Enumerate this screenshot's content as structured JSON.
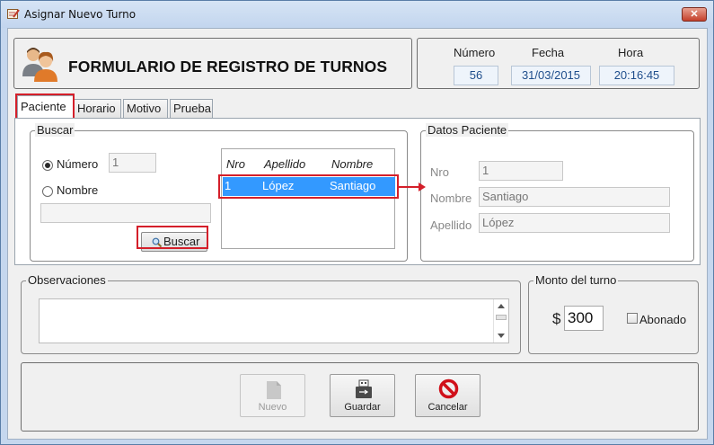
{
  "window": {
    "title": "Asignar Nuevo Turno",
    "close_glyph": "✕",
    "icon": "form-pencil-icon"
  },
  "header": {
    "title": "FORMULARIO DE REGISTRO DE TURNOS",
    "icon": "users-icon",
    "numero_label": "Número",
    "fecha_label": "Fecha",
    "hora_label": "Hora",
    "numero_value": "56",
    "fecha_value": "31/03/2015",
    "hora_value": "20:16:45"
  },
  "tabs": [
    {
      "label": "Paciente",
      "active": true
    },
    {
      "label": "Horario",
      "active": false
    },
    {
      "label": "Motivo",
      "active": false
    },
    {
      "label": "Prueba",
      "active": false
    }
  ],
  "buscar": {
    "legend": "Buscar",
    "radio_numero_label": "Número",
    "radio_nombre_label": "Nombre",
    "selected": "numero",
    "numero_value": "1",
    "nombre_value": "",
    "button_label": "Buscar"
  },
  "results_grid": {
    "columns": [
      "Nro",
      "Apellido",
      "Nombre"
    ],
    "rows": [
      {
        "nro": "1",
        "apellido": "López",
        "nombre": "Santiago",
        "selected": true
      }
    ]
  },
  "datos_paciente": {
    "legend": "Datos Paciente",
    "nro_label": "Nro",
    "nro_value": "1",
    "nombre_label": "Nombre",
    "nombre_value": "Santiago",
    "apellido_label": "Apellido",
    "apellido_value": "López"
  },
  "observaciones": {
    "legend": "Observaciones",
    "value": ""
  },
  "monto": {
    "legend": "Monto del turno",
    "currency": "$",
    "value": "300",
    "abonado_label": "Abonado",
    "abonado_checked": false
  },
  "actions": {
    "nuevo_label": "Nuevo",
    "guardar_label": "Guardar",
    "cancelar_label": "Cancelar"
  },
  "colors": {
    "highlight_red": "#d41f2a",
    "selection_blue": "#3399ff",
    "info_text_blue": "#1f4e8c"
  }
}
